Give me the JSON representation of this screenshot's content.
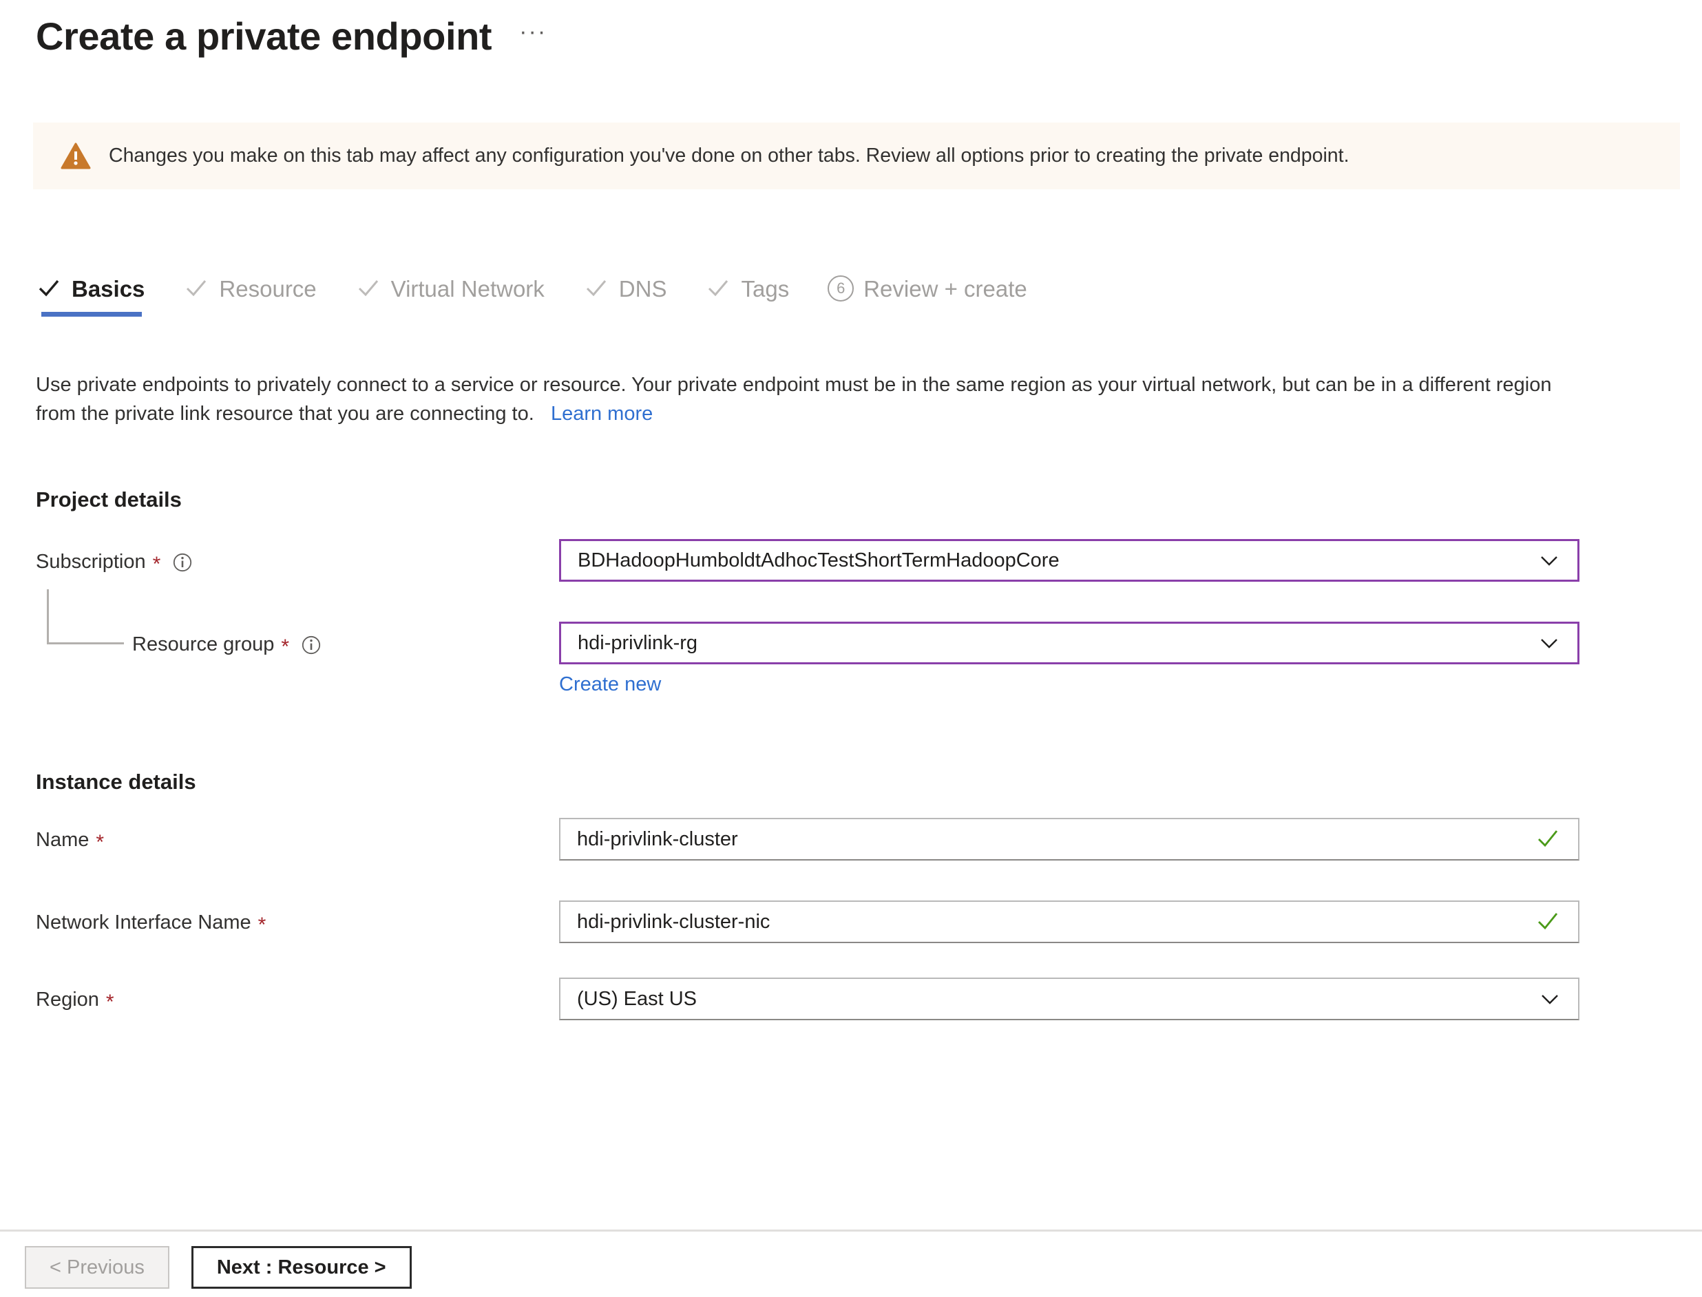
{
  "header": {
    "title": "Create a private endpoint",
    "ellipsis": "···"
  },
  "banner": {
    "icon": "warning-triangle-icon",
    "text": "Changes you make on this tab may affect any configuration you've done on other tabs. Review all options prior to creating the private endpoint.",
    "background": "#fdf8f2",
    "icon_color": "#c8792b"
  },
  "tabs": [
    {
      "label": "Basics",
      "state": "active",
      "icon": "checkmark-icon"
    },
    {
      "label": "Resource",
      "state": "inactive",
      "icon": "checkmark-icon"
    },
    {
      "label": "Virtual Network",
      "state": "inactive",
      "icon": "checkmark-icon"
    },
    {
      "label": "DNS",
      "state": "inactive",
      "icon": "checkmark-icon"
    },
    {
      "label": "Tags",
      "state": "inactive",
      "icon": "checkmark-icon"
    },
    {
      "label": "Review + create",
      "state": "inactive",
      "icon": "number-badge",
      "badge": "6"
    }
  ],
  "description": {
    "text": "Use private endpoints to privately connect to a service or resource. Your private endpoint must be in the same region as your virtual network, but can be in a different region from the private link resource that you are connecting to.",
    "learn_more": "Learn more"
  },
  "project_details": {
    "section_title": "Project details",
    "subscription": {
      "label": "Subscription",
      "required": "*",
      "value": "BDHadoopHumboldtAdhocTestShortTermHadoopCore",
      "border_color": "#8a3faa",
      "chevron": "chevron-down-icon"
    },
    "resource_group": {
      "label": "Resource group",
      "required": "*",
      "value": "hdi-privlink-rg",
      "border_color": "#8a3faa",
      "chevron": "chevron-down-icon",
      "create_new": "Create new"
    }
  },
  "instance_details": {
    "section_title": "Instance details",
    "name": {
      "label": "Name",
      "required": "*",
      "value": "hdi-privlink-cluster",
      "validation": "valid-checkmark-icon",
      "validation_color": "#4a9a18"
    },
    "nic": {
      "label": "Network Interface Name",
      "required": "*",
      "value": "hdi-privlink-cluster-nic",
      "validation": "valid-checkmark-icon",
      "validation_color": "#4a9a18"
    },
    "region": {
      "label": "Region",
      "required": "*",
      "value": "(US) East US",
      "chevron": "chevron-down-icon"
    }
  },
  "footer": {
    "previous": "< Previous",
    "next": "Next : Resource >"
  },
  "colors": {
    "accent_blue": "#4a72c4",
    "link_blue": "#2f6fd0",
    "required_red": "#a4262c"
  }
}
